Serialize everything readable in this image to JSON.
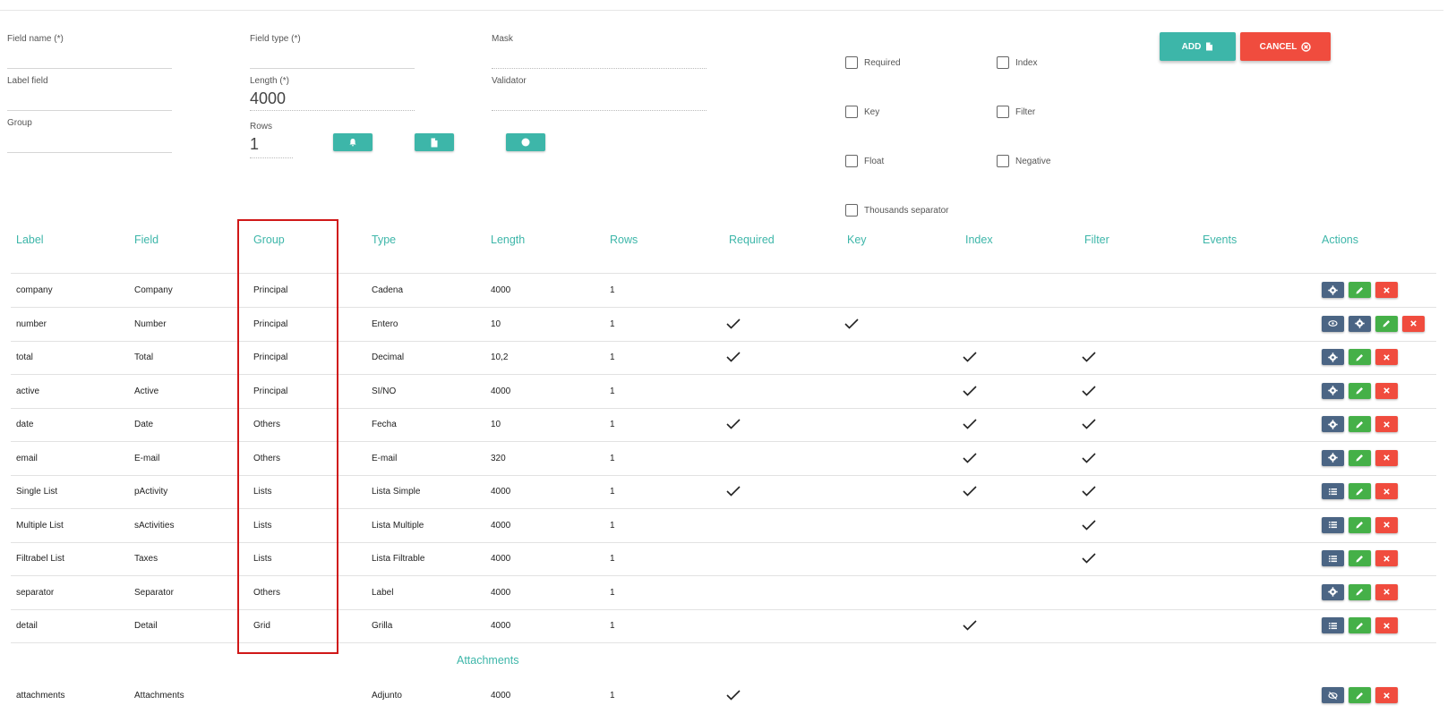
{
  "form": {
    "field_name_label": "Field name (*)",
    "field_type_label": "Field type (*)",
    "mask_label": "Mask",
    "label_field_label": "Label field",
    "length_label": "Length (*)",
    "length_value": "4000",
    "validator_label": "Validator",
    "group_label": "Group",
    "rows_label": "Rows",
    "rows_value": "1",
    "checkboxes": [
      {
        "label": "Required",
        "checked": false
      },
      {
        "label": "Index",
        "checked": false
      },
      {
        "label": "Key",
        "checked": false
      },
      {
        "label": "Filter",
        "checked": false
      },
      {
        "label": "Float",
        "checked": false
      },
      {
        "label": "Negative",
        "checked": false
      },
      {
        "label": "Thousands separator",
        "checked": false
      }
    ],
    "add_label": "ADD",
    "cancel_label": "CANCEL"
  },
  "table": {
    "headers": [
      "Label",
      "Field",
      "Group",
      "Type",
      "Length",
      "Rows",
      "Required",
      "Key",
      "Index",
      "Filter",
      "Events",
      "Actions"
    ],
    "rows": [
      {
        "label": "company",
        "field": "Company",
        "group": "Principal",
        "type": "Cadena",
        "length": "4000",
        "rows": "1",
        "required": false,
        "key": false,
        "index": false,
        "filter": false,
        "actions": [
          "gear",
          "edit",
          "delete"
        ]
      },
      {
        "label": "number",
        "field": "Number",
        "group": "Principal",
        "type": "Entero",
        "length": "10",
        "rows": "1",
        "required": true,
        "key": true,
        "index": false,
        "filter": false,
        "actions": [
          "eye",
          "gear",
          "edit",
          "delete"
        ]
      },
      {
        "label": "total",
        "field": "Total",
        "group": "Principal",
        "type": "Decimal",
        "length": "10,2",
        "rows": "1",
        "required": true,
        "key": false,
        "index": true,
        "filter": true,
        "actions": [
          "gear",
          "edit",
          "delete"
        ]
      },
      {
        "label": "active",
        "field": "Active",
        "group": "Principal",
        "type": "SI/NO",
        "length": "4000",
        "rows": "1",
        "required": false,
        "key": false,
        "index": true,
        "filter": true,
        "actions": [
          "gear",
          "edit",
          "delete"
        ]
      },
      {
        "label": "date",
        "field": "Date",
        "group": "Others",
        "type": "Fecha",
        "length": "10",
        "rows": "1",
        "required": true,
        "key": false,
        "index": true,
        "filter": true,
        "actions": [
          "gear",
          "edit",
          "delete"
        ]
      },
      {
        "label": "email",
        "field": "E-mail",
        "group": "Others",
        "type": "E-mail",
        "length": "320",
        "rows": "1",
        "required": false,
        "key": false,
        "index": true,
        "filter": true,
        "actions": [
          "gear",
          "edit",
          "delete"
        ]
      },
      {
        "label": "Single List",
        "field": "pActivity",
        "group": "Lists",
        "type": "Lista Simple",
        "length": "4000",
        "rows": "1",
        "required": true,
        "key": false,
        "index": true,
        "filter": true,
        "actions": [
          "list",
          "edit",
          "delete"
        ]
      },
      {
        "label": "Multiple List",
        "field": "sActivities",
        "group": "Lists",
        "type": "Lista Multiple",
        "length": "4000",
        "rows": "1",
        "required": false,
        "key": false,
        "index": false,
        "filter": true,
        "actions": [
          "list",
          "edit",
          "delete"
        ]
      },
      {
        "label": "Filtrabel List",
        "field": "Taxes",
        "group": "Lists",
        "type": "Lista Filtrable",
        "length": "4000",
        "rows": "1",
        "required": false,
        "key": false,
        "index": false,
        "filter": true,
        "actions": [
          "list",
          "edit",
          "delete"
        ]
      },
      {
        "label": "separator",
        "field": "Separator",
        "group": "Others",
        "type": "Label",
        "length": "4000",
        "rows": "1",
        "required": false,
        "key": false,
        "index": false,
        "filter": false,
        "actions": [
          "gear",
          "edit",
          "delete"
        ]
      },
      {
        "label": "detail",
        "field": "Detail",
        "group": "Grid",
        "type": "Grilla",
        "length": "4000",
        "rows": "1",
        "required": false,
        "key": false,
        "index": true,
        "filter": false,
        "actions": [
          "list",
          "edit",
          "delete"
        ]
      }
    ],
    "section_title": "Attachments",
    "attachment_row": {
      "label": "attachments",
      "field": "Attachments",
      "group": "",
      "type": "Adjunto",
      "length": "4000",
      "rows": "1",
      "required": true,
      "key": false,
      "index": false,
      "filter": false,
      "actions": [
        "eye-off",
        "edit",
        "delete"
      ]
    }
  },
  "colors": {
    "accent": "#3db6a9",
    "danger": "#f04c3e",
    "success": "#45b048",
    "dark": "#4b6584",
    "highlight": "#d01818"
  }
}
